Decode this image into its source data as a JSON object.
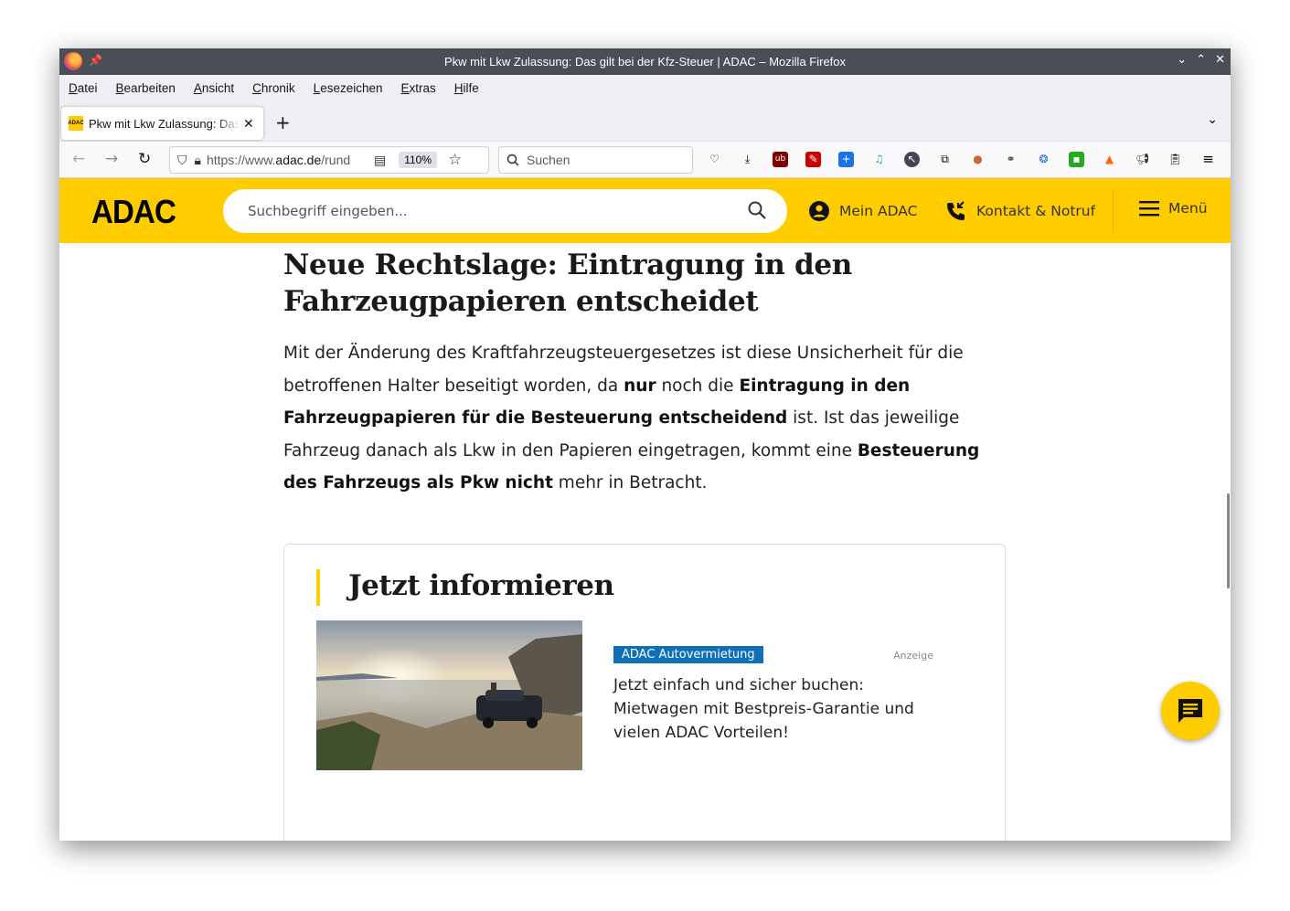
{
  "window": {
    "title": "Pkw mit Lkw Zulassung: Das gilt bei der Kfz-Steuer | ADAC – Mozilla Firefox",
    "controls": [
      "⌄",
      "⌃",
      "✕"
    ]
  },
  "menu": {
    "items": [
      {
        "label": "Datei",
        "key": "D",
        "rest": "atei"
      },
      {
        "label": "Bearbeiten",
        "key": "B",
        "rest": "earbeiten"
      },
      {
        "label": "Ansicht",
        "key": "A",
        "rest": "nsicht"
      },
      {
        "label": "Chronik",
        "key": "C",
        "rest": "hronik"
      },
      {
        "label": "Lesezeichen",
        "key": "L",
        "rest": "esezeichen"
      },
      {
        "label": "Extras",
        "key": "E",
        "rest": "xtras"
      },
      {
        "label": "Hilfe",
        "key": "H",
        "rest": "ilfe"
      }
    ]
  },
  "tab": {
    "title": "Pkw mit Lkw Zulassung: Das gilt bei der Kfz-Steuer | ADAC",
    "favicon_text": "ADAC"
  },
  "nav": {
    "url_prefix": "https://www.",
    "url_domain": "adac.de",
    "url_rest": "/rund",
    "zoom": "110%",
    "search_placeholder": "Suchen"
  },
  "site": {
    "logo": "ADAC",
    "search_placeholder": "Suchbegriff eingeben...",
    "mein_adac": "Mein ADAC",
    "kontakt": "Kontakt & Notruf",
    "menu": "Menü"
  },
  "article": {
    "heading": "Neue Rechtslage: Eintragung in den Fahrzeugpapieren entscheidet",
    "p1": "Mit der Änderung des Kraftfahrzeugsteuergesetzes ist diese Unsicherheit für die betroffenen Halter beseitigt worden, da ",
    "b1": "nur",
    "p2": " noch die ",
    "b2": "Eintragung in den Fahrzeugpapieren für die Besteuerung entscheidend",
    "p3": " ist. Ist das jeweilige Fahrzeug danach als Lkw in den Papieren eingetragen, kommt eine ",
    "b3": "Besteuerung des Fahrzeugs als Pkw nicht",
    "p4": " mehr in Betracht."
  },
  "infobox": {
    "title": "Jetzt informieren",
    "tag": "ADAC Autovermietung",
    "label": "Anzeige",
    "text": "Jetzt einfach und sicher buchen: Mietwagen mit Bestpreis-Garantie und vielen ADAC Vorteilen!"
  },
  "colors": {
    "brand_yellow": "#ffcc00",
    "tag_blue": "#0f6fb7"
  }
}
